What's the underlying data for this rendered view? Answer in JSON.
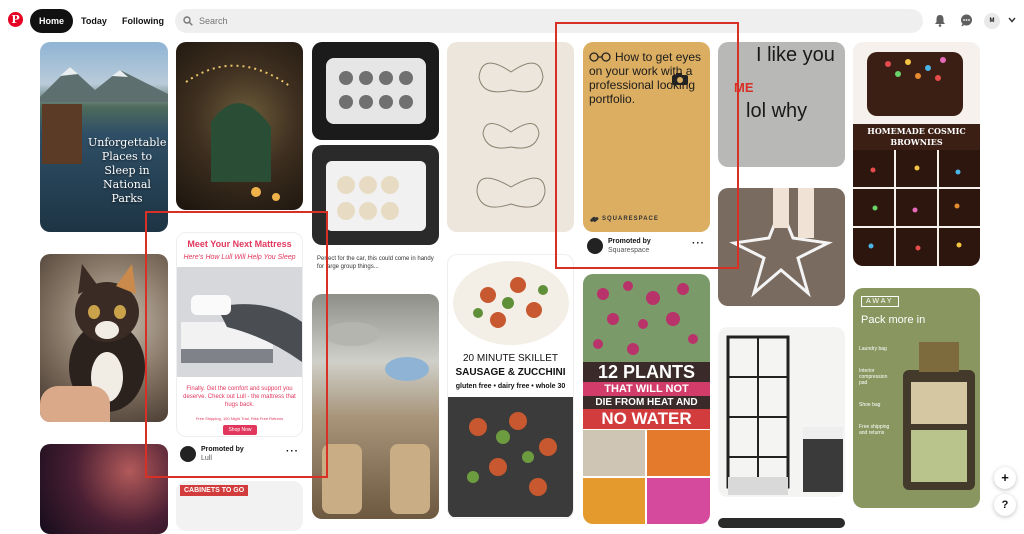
{
  "nav": {
    "home": "Home",
    "today": "Today",
    "following": "Following"
  },
  "search": {
    "placeholder": "Search"
  },
  "account": {
    "initial": "M"
  },
  "pins": {
    "parks": {
      "title": "Unforgettable Places to Sleep in National Parks"
    },
    "mattress": {
      "headline": "Meet Your Next Mattress",
      "script": "Here's How Lull Will Help You Sleep",
      "body": "Finally. Get the comfort and support you deserve. Check out Lull - the mattress that hugs back.",
      "shipping": "Free Shipping, 100 Night Trial, Risk Free Returns",
      "cta": "Shop Now",
      "promoted": "Promoted by",
      "brand": "Lull"
    },
    "car_caption": "Perfect for the car, this could come in handy for large group things...",
    "skillet": {
      "line1": "20 MINUTE SKILLET",
      "line2": "SAUSAGE & ZUCCHINI",
      "line3": "gluten free • dairy free • whole 30"
    },
    "portfolio": {
      "text": "How to get eyes on your work with a professional looking portfolio.",
      "brand_mark": "SQUARESPACE",
      "promoted": "Promoted by",
      "brand": "Squarespace"
    },
    "plants": {
      "line1": "12 PLANTS",
      "line2": "THAT WILL NOT",
      "line3": "DIE FROM HEAT AND",
      "line4": "NO WATER"
    },
    "meme": {
      "line1": "I like you",
      "me": "ME",
      "line2": "lol why"
    },
    "brownies": {
      "title": "HOMEMADE COSMIC BROWNIES"
    },
    "away": {
      "brand": "AWAY",
      "headline": "Pack more in",
      "features": [
        "Laundry bag",
        "Interior compression pad",
        "Shoe bag",
        "Free shipping and returns"
      ]
    },
    "cabinets": {
      "text": "CABINETS TO GO"
    }
  },
  "colors": {
    "brand_red": "#e60023",
    "highlight_red": "#d93025"
  }
}
